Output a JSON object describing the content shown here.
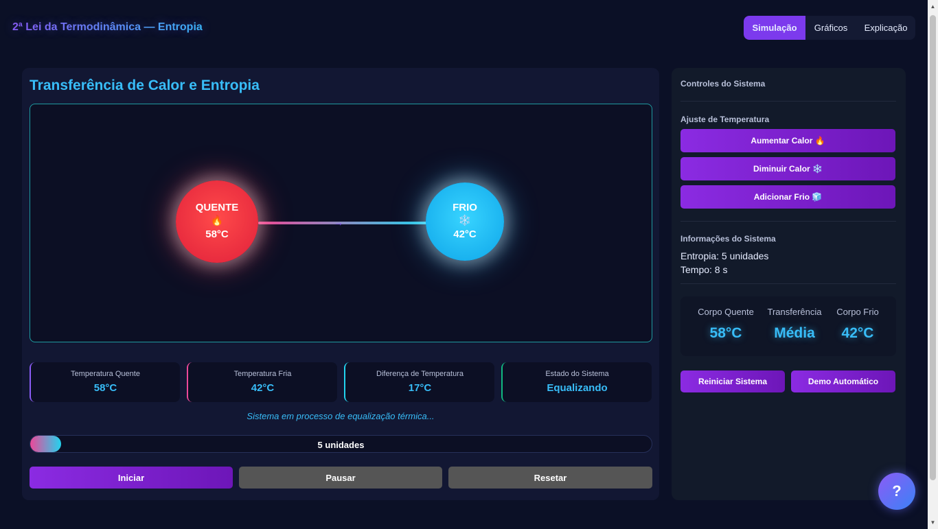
{
  "header": {
    "title": "2ª Lei da Termodinâmica — Entropia",
    "tabs": [
      {
        "label": "Simulação",
        "active": true
      },
      {
        "label": "Gráficos",
        "active": false
      },
      {
        "label": "Explicação",
        "active": false
      }
    ]
  },
  "main": {
    "title": "Transferência de Calor e Entropia",
    "hot_body": {
      "label": "QUENTE",
      "icon": "🔥",
      "temp": "58°C"
    },
    "cold_body": {
      "label": "FRIO",
      "icon": "❄️",
      "temp": "42°C"
    },
    "arrow": "→",
    "stats": [
      {
        "label": "Temperatura Quente",
        "value": "58°C"
      },
      {
        "label": "Temperatura Fria",
        "value": "42°C"
      },
      {
        "label": "Diferença de Temperatura",
        "value": "17°C"
      },
      {
        "label": "Estado do Sistema",
        "value": "Equalizando"
      }
    ],
    "status": "Sistema em processo de equalização térmica...",
    "entropy_bar": {
      "label": "5 unidades",
      "fill_fraction": 0.05
    },
    "buttons": {
      "start": "Iniciar",
      "pause": "Pausar",
      "reset": "Resetar"
    }
  },
  "side": {
    "controls_title": "Controles do Sistema",
    "temp_title": "Ajuste de Temperatura",
    "temp_buttons": [
      "Aumentar Calor 🔥",
      "Diminuir Calor ❄️",
      "Adicionar Frio 🧊"
    ],
    "info_title": "Informações do Sistema",
    "entropy_line": "Entropia: 5 unidades",
    "time_line": "Tempo: 8 s",
    "summary": [
      {
        "label": "Corpo Quente",
        "value": "58°C"
      },
      {
        "label": "Transferência",
        "value": "Média"
      },
      {
        "label": "Corpo Frio",
        "value": "42°C"
      }
    ],
    "restart": "Reiniciar Sistema",
    "demo": "Demo Automático"
  },
  "help": {
    "label": "?"
  },
  "colors": {
    "background": "#0b1026",
    "accent_purple": "#7c3aed",
    "accent_cyan": "#38bdf8",
    "hot": "#ff3b3b",
    "cold": "#0ea5e9"
  }
}
